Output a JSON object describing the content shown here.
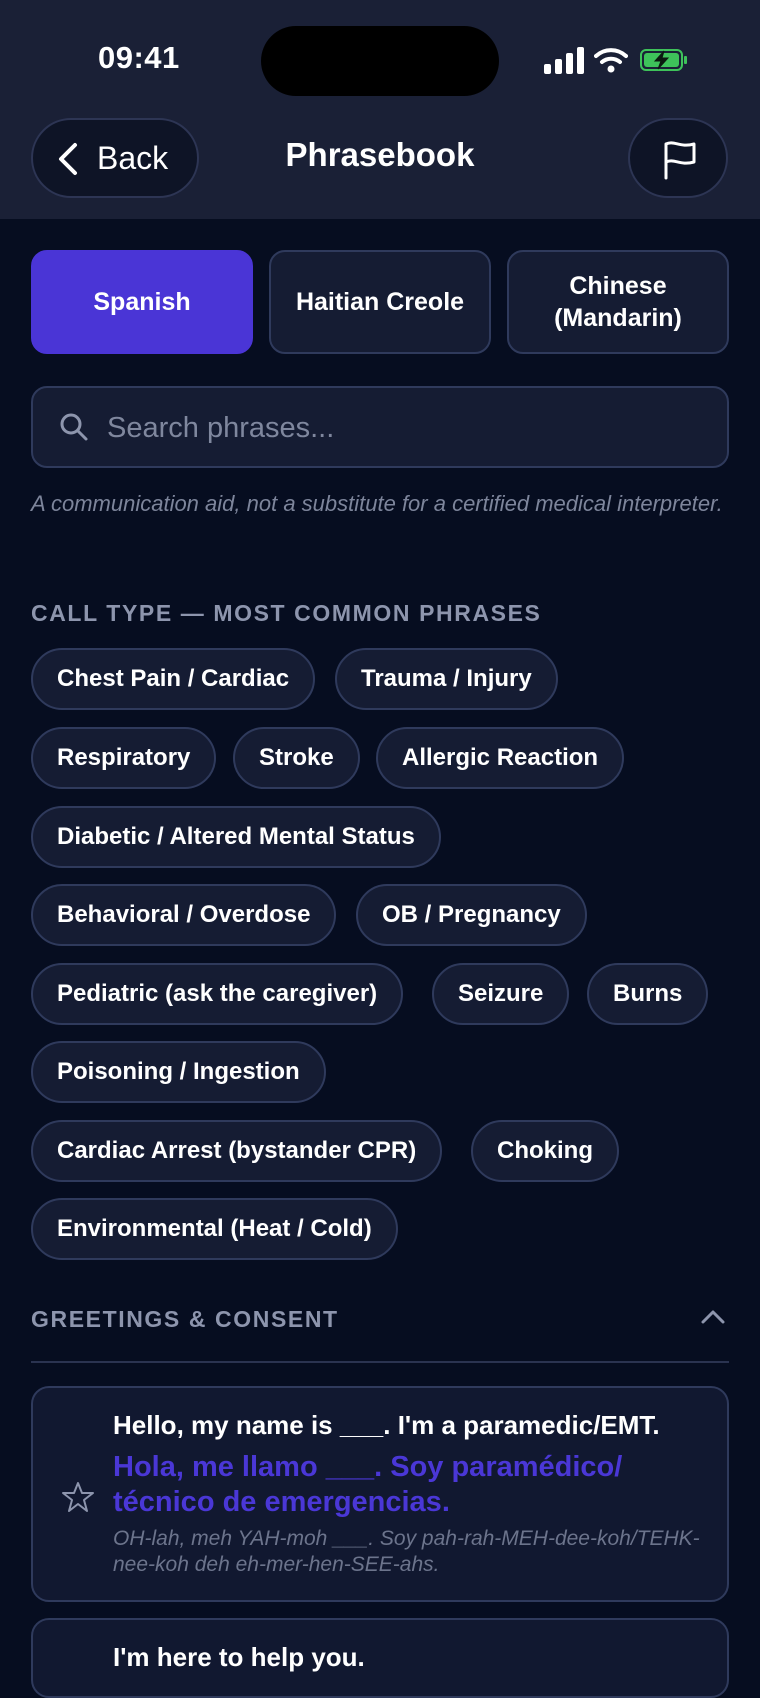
{
  "status": {
    "time": "09:41"
  },
  "header": {
    "back_label": "Back",
    "title": "Phrasebook"
  },
  "languages": [
    {
      "label": "Spanish",
      "active": true
    },
    {
      "label": "Haitian Creole",
      "active": false
    },
    {
      "label": "Chinese (Mandarin)",
      "active": false
    }
  ],
  "search": {
    "placeholder": "Search phrases...",
    "value": ""
  },
  "disclaimer": "A communication aid, not a substitute for a certified medical interpreter.",
  "call_type": {
    "heading": "CALL TYPE — MOST COMMON PHRASES",
    "chips": [
      "Chest Pain / Cardiac",
      "Trauma / Injury",
      "Respiratory",
      "Stroke",
      "Allergic Reaction",
      "Diabetic / Altered Mental Status",
      "Behavioral / Overdose",
      "OB / Pregnancy",
      "Pediatric (ask the caregiver)",
      "Seizure",
      "Burns",
      "Poisoning / Ingestion",
      "Cardiac Arrest (bystander CPR)",
      "Choking",
      "Environmental (Heat / Cold)"
    ]
  },
  "greetings": {
    "heading": "GREETINGS & CONSENT",
    "expanded": true,
    "phrases": [
      {
        "english": "Hello, my name is ___. I'm a paramedic/EMT.",
        "translation": "Hola, me llamo ___. Soy paramédico/ técnico de emergencias.",
        "pronunciation": "OH-lah, meh YAH-moh ___. Soy pah-rah-MEH-dee-koh/TEHK-nee-koh deh eh-mer-hen-SEE-ahs.",
        "favorite": false
      },
      {
        "english": "I'm here to help you.",
        "favorite": false
      }
    ]
  },
  "colors": {
    "accent": "#4a35d6",
    "background": "#060d20",
    "surface": "#151c33",
    "border": "#2f3a5c"
  }
}
